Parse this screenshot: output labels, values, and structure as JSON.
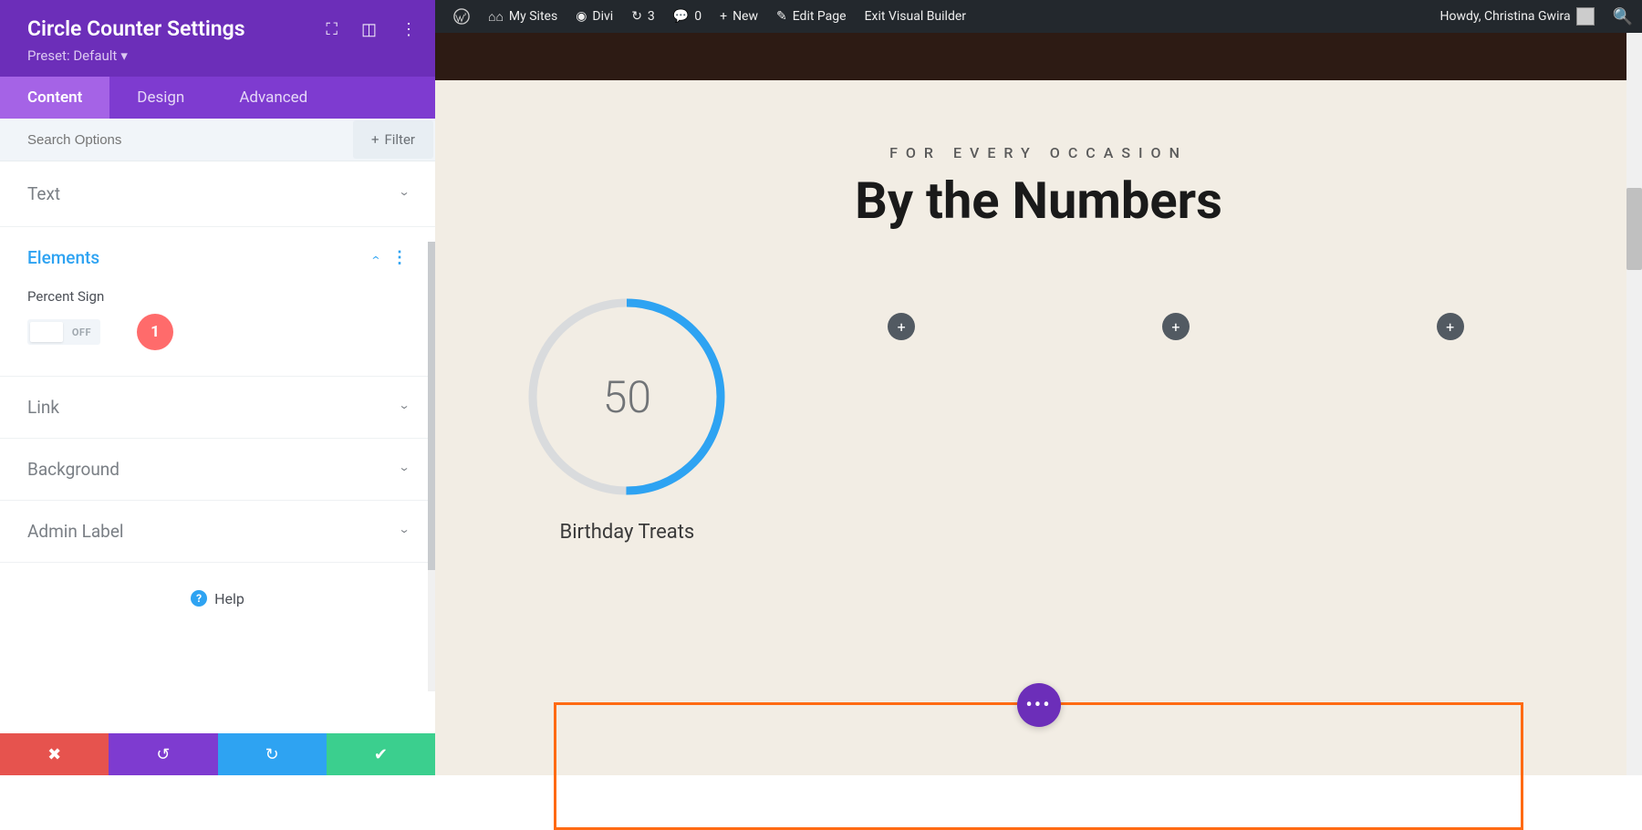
{
  "panel": {
    "title": "Circle Counter Settings",
    "preset": "Preset: Default",
    "tabs": [
      "Content",
      "Design",
      "Advanced"
    ],
    "activeTab": 0,
    "search_placeholder": "Search Options",
    "filter_label": "Filter",
    "sections": {
      "text": "Text",
      "elements": "Elements",
      "link": "Link",
      "background": "Background",
      "admin_label": "Admin Label"
    },
    "percent_sign_label": "Percent Sign",
    "percent_sign_state": "OFF",
    "annotation_badge": "1",
    "help_label": "Help"
  },
  "wp_bar": {
    "my_sites": "My Sites",
    "divi": "Divi",
    "updates": "3",
    "comments": "0",
    "new": "New",
    "edit_page": "Edit Page",
    "exit_builder": "Exit Visual Builder",
    "howdy": "Howdy, Christina Gwira"
  },
  "page": {
    "subtitle": "FOR EVERY OCCASION",
    "title": "By the Numbers",
    "counter_value": "50",
    "counter_label": "Birthday Treats"
  }
}
